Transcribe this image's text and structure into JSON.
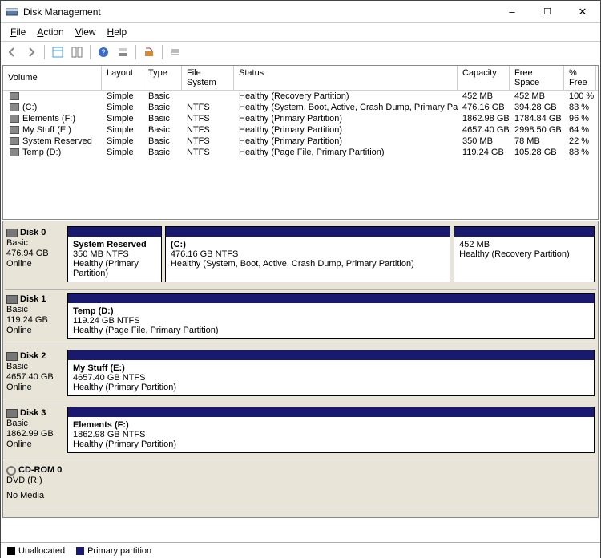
{
  "window": {
    "title": "Disk Management"
  },
  "menu": {
    "file": "File",
    "action": "Action",
    "view": "View",
    "help": "Help"
  },
  "columns": {
    "volume": "Volume",
    "layout": "Layout",
    "type": "Type",
    "fs": "File System",
    "status": "Status",
    "capacity": "Capacity",
    "free": "Free Space",
    "pfree": "% Free"
  },
  "volumes": [
    {
      "name": "",
      "layout": "Simple",
      "type": "Basic",
      "fs": "",
      "status": "Healthy (Recovery Partition)",
      "capacity": "452 MB",
      "free": "452 MB",
      "pfree": "100 %"
    },
    {
      "name": "(C:)",
      "layout": "Simple",
      "type": "Basic",
      "fs": "NTFS",
      "status": "Healthy (System, Boot, Active, Crash Dump, Primary Partition)",
      "capacity": "476.16 GB",
      "free": "394.28 GB",
      "pfree": "83 %"
    },
    {
      "name": "Elements (F:)",
      "layout": "Simple",
      "type": "Basic",
      "fs": "NTFS",
      "status": "Healthy (Primary Partition)",
      "capacity": "1862.98 GB",
      "free": "1784.84 GB",
      "pfree": "96 %"
    },
    {
      "name": "My Stuff (E:)",
      "layout": "Simple",
      "type": "Basic",
      "fs": "NTFS",
      "status": "Healthy (Primary Partition)",
      "capacity": "4657.40 GB",
      "free": "2998.50 GB",
      "pfree": "64 %"
    },
    {
      "name": "System Reserved",
      "layout": "Simple",
      "type": "Basic",
      "fs": "NTFS",
      "status": "Healthy (Primary Partition)",
      "capacity": "350 MB",
      "free": "78 MB",
      "pfree": "22 %"
    },
    {
      "name": "Temp (D:)",
      "layout": "Simple",
      "type": "Basic",
      "fs": "NTFS",
      "status": "Healthy (Page File, Primary Partition)",
      "capacity": "119.24 GB",
      "free": "105.28 GB",
      "pfree": "88 %"
    }
  ],
  "disks": [
    {
      "name": "Disk 0",
      "type": "Basic",
      "size": "476.94 GB",
      "state": "Online",
      "icon": "disk",
      "parts": [
        {
          "title": "System Reserved",
          "sub": "350 MB NTFS",
          "status": "Healthy (Primary Partition)",
          "flex": "0.18"
        },
        {
          "title": " (C:)",
          "sub": "476.16 GB NTFS",
          "status": "Healthy (System, Boot, Active, Crash Dump, Primary Partition)",
          "flex": "0.55"
        },
        {
          "title": "",
          "sub": "452 MB",
          "status": "Healthy (Recovery Partition)",
          "flex": "0.27"
        }
      ]
    },
    {
      "name": "Disk 1",
      "type": "Basic",
      "size": "119.24 GB",
      "state": "Online",
      "icon": "disk",
      "parts": [
        {
          "title": "Temp  (D:)",
          "sub": "119.24 GB NTFS",
          "status": "Healthy (Page File, Primary Partition)",
          "flex": "1"
        }
      ]
    },
    {
      "name": "Disk 2",
      "type": "Basic",
      "size": "4657.40 GB",
      "state": "Online",
      "icon": "disk",
      "parts": [
        {
          "title": "My Stuff  (E:)",
          "sub": "4657.40 GB NTFS",
          "status": "Healthy (Primary Partition)",
          "flex": "1"
        }
      ]
    },
    {
      "name": "Disk 3",
      "type": "Basic",
      "size": "1862.99 GB",
      "state": "Online",
      "icon": "disk",
      "parts": [
        {
          "title": "Elements  (F:)",
          "sub": "1862.98 GB NTFS",
          "status": "Healthy (Primary Partition)",
          "flex": "1"
        }
      ]
    },
    {
      "name": "CD-ROM 0",
      "type": "DVD (R:)",
      "size": "",
      "state": "No Media",
      "icon": "cd",
      "parts": []
    }
  ],
  "legend": {
    "unallocated": "Unallocated",
    "primary": "Primary partition"
  }
}
